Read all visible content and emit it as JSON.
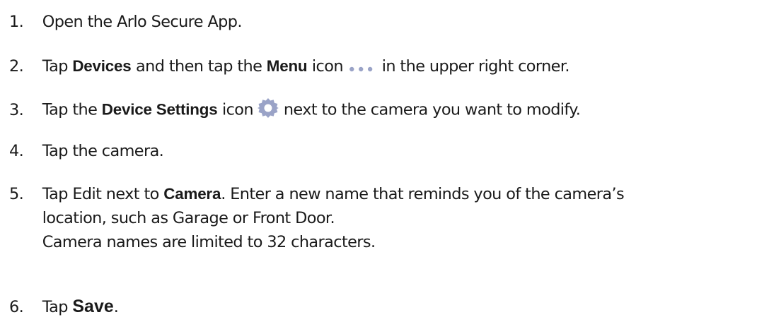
{
  "steps": [
    {
      "number": "1.",
      "text": "Open the Arlo Secure App."
    },
    {
      "number": "2.",
      "pre": "Tap ",
      "b1": "Devices",
      "mid": " and then tap the ",
      "b2": "Menu",
      "post_icon": " icon ",
      "post": " in the  upper right corner.",
      "icon": "ellipsis-menu-icon"
    },
    {
      "number": "3.",
      "pre": "Tap the ",
      "b1": "Device Settings",
      "mid": " icon ",
      "post": " next to the camera you want to modify.",
      "icon": "gear-icon"
    },
    {
      "number": "4.",
      "text": "Tap the camera."
    },
    {
      "number": "5.",
      "pre": "Tap Edit next to ",
      "b1": "Camera",
      "post": ". Enter a new name that reminds you of the camera’s",
      "line2": "location, such as Garage or Front Door.",
      "line3": "Camera names are limited to 32 characters."
    },
    {
      "number": "6.",
      "pre": "Tap ",
      "b1": "Save",
      "post": "."
    }
  ],
  "colors": {
    "text": "#1a1a1a",
    "icon": "#9aa3c7"
  }
}
